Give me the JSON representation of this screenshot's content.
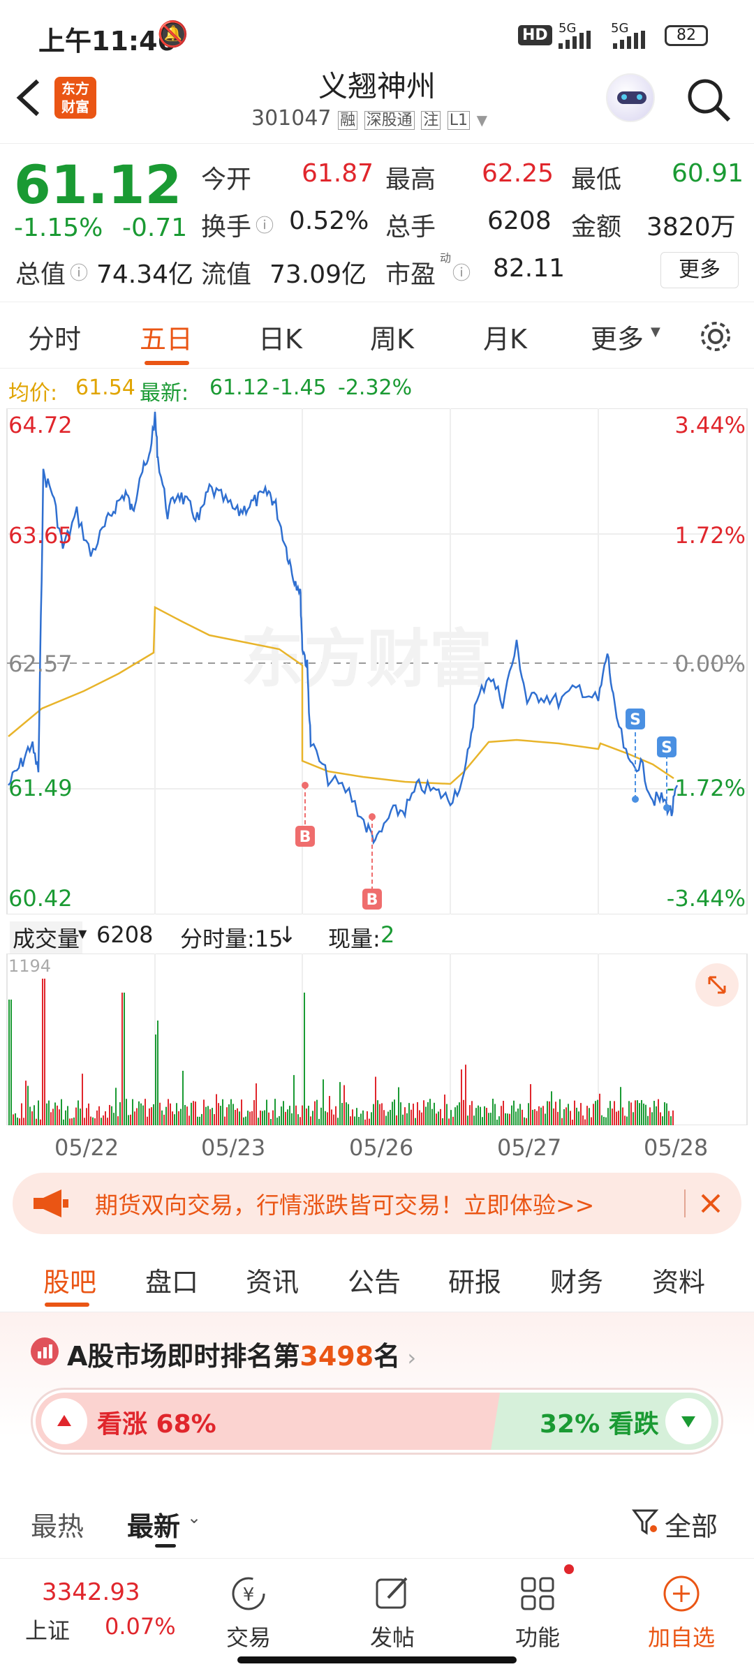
{
  "status": {
    "time": "上午11:46",
    "hd": "HD",
    "net1": "5G",
    "net2": "5G",
    "battery": "82"
  },
  "header": {
    "logo": "东方\n财富",
    "name": "义翘神州",
    "code": "301047",
    "tags": [
      "融",
      "深股通",
      "注",
      "L1"
    ]
  },
  "quote": {
    "price": "61.12",
    "pct": "-1.15%",
    "chg": "-0.71",
    "open_l": "今开",
    "open": "61.87",
    "high_l": "最高",
    "high": "62.25",
    "low_l": "最低",
    "low": "60.91",
    "turn_l": "换手",
    "turn": "0.52%",
    "vol_l": "总手",
    "vol": "6208",
    "amt_l": "金额",
    "amt": "3820万",
    "mcap_l": "总值",
    "mcap": "74.34亿",
    "fcap_l": "流值",
    "fcap": "73.09亿",
    "pe_l": "市盈",
    "pe_sup": "动",
    "pe": "82.11",
    "more": "更多"
  },
  "tabs": [
    "分时",
    "五日",
    "日K",
    "周K",
    "月K",
    "更多"
  ],
  "info": {
    "avg_l": "均价:",
    "avg": "61.54",
    "latest_l": "最新:",
    "latest": "61.12",
    "chg": "-1.45",
    "pct": "-2.32%"
  },
  "chart_data": {
    "type": "line",
    "title": "",
    "ylim": [
      60.42,
      64.72
    ],
    "y_ticks_left": [
      "64.72",
      "63.65",
      "62.57",
      "61.49",
      "60.42"
    ],
    "y_ticks_right": [
      "3.44%",
      "1.72%",
      "0.00%",
      "-1.72%",
      "-3.44%"
    ],
    "x": [
      "05/22",
      "05/23",
      "05/26",
      "05/27",
      "05/28"
    ],
    "series": [],
    "trade_marks": [
      "B",
      "B",
      "S",
      "S"
    ],
    "volume": {
      "label": "成交量",
      "value": "6208",
      "period": "分时量:15",
      "now_l": "现量:",
      "now": "2",
      "max": "1194"
    }
  },
  "banner": {
    "text": "期货双向交易，行情涨跌皆可交易！立即体验>>"
  },
  "news_tabs": [
    "股吧",
    "盘口",
    "资讯",
    "公告",
    "研报",
    "财务",
    "资料"
  ],
  "rank": {
    "prefix": "A股市场即时排名第",
    "num": "3498",
    "suffix": "名",
    "up": "看涨 68%",
    "down": "32% 看跌"
  },
  "sort": {
    "hot": "最热",
    "new": "最新",
    "all": "全部"
  },
  "bottom": {
    "index": "3342.93",
    "index_name": "上证",
    "index_pct": "0.07%",
    "items": [
      "交易",
      "发帖",
      "功能",
      "加自选"
    ]
  }
}
